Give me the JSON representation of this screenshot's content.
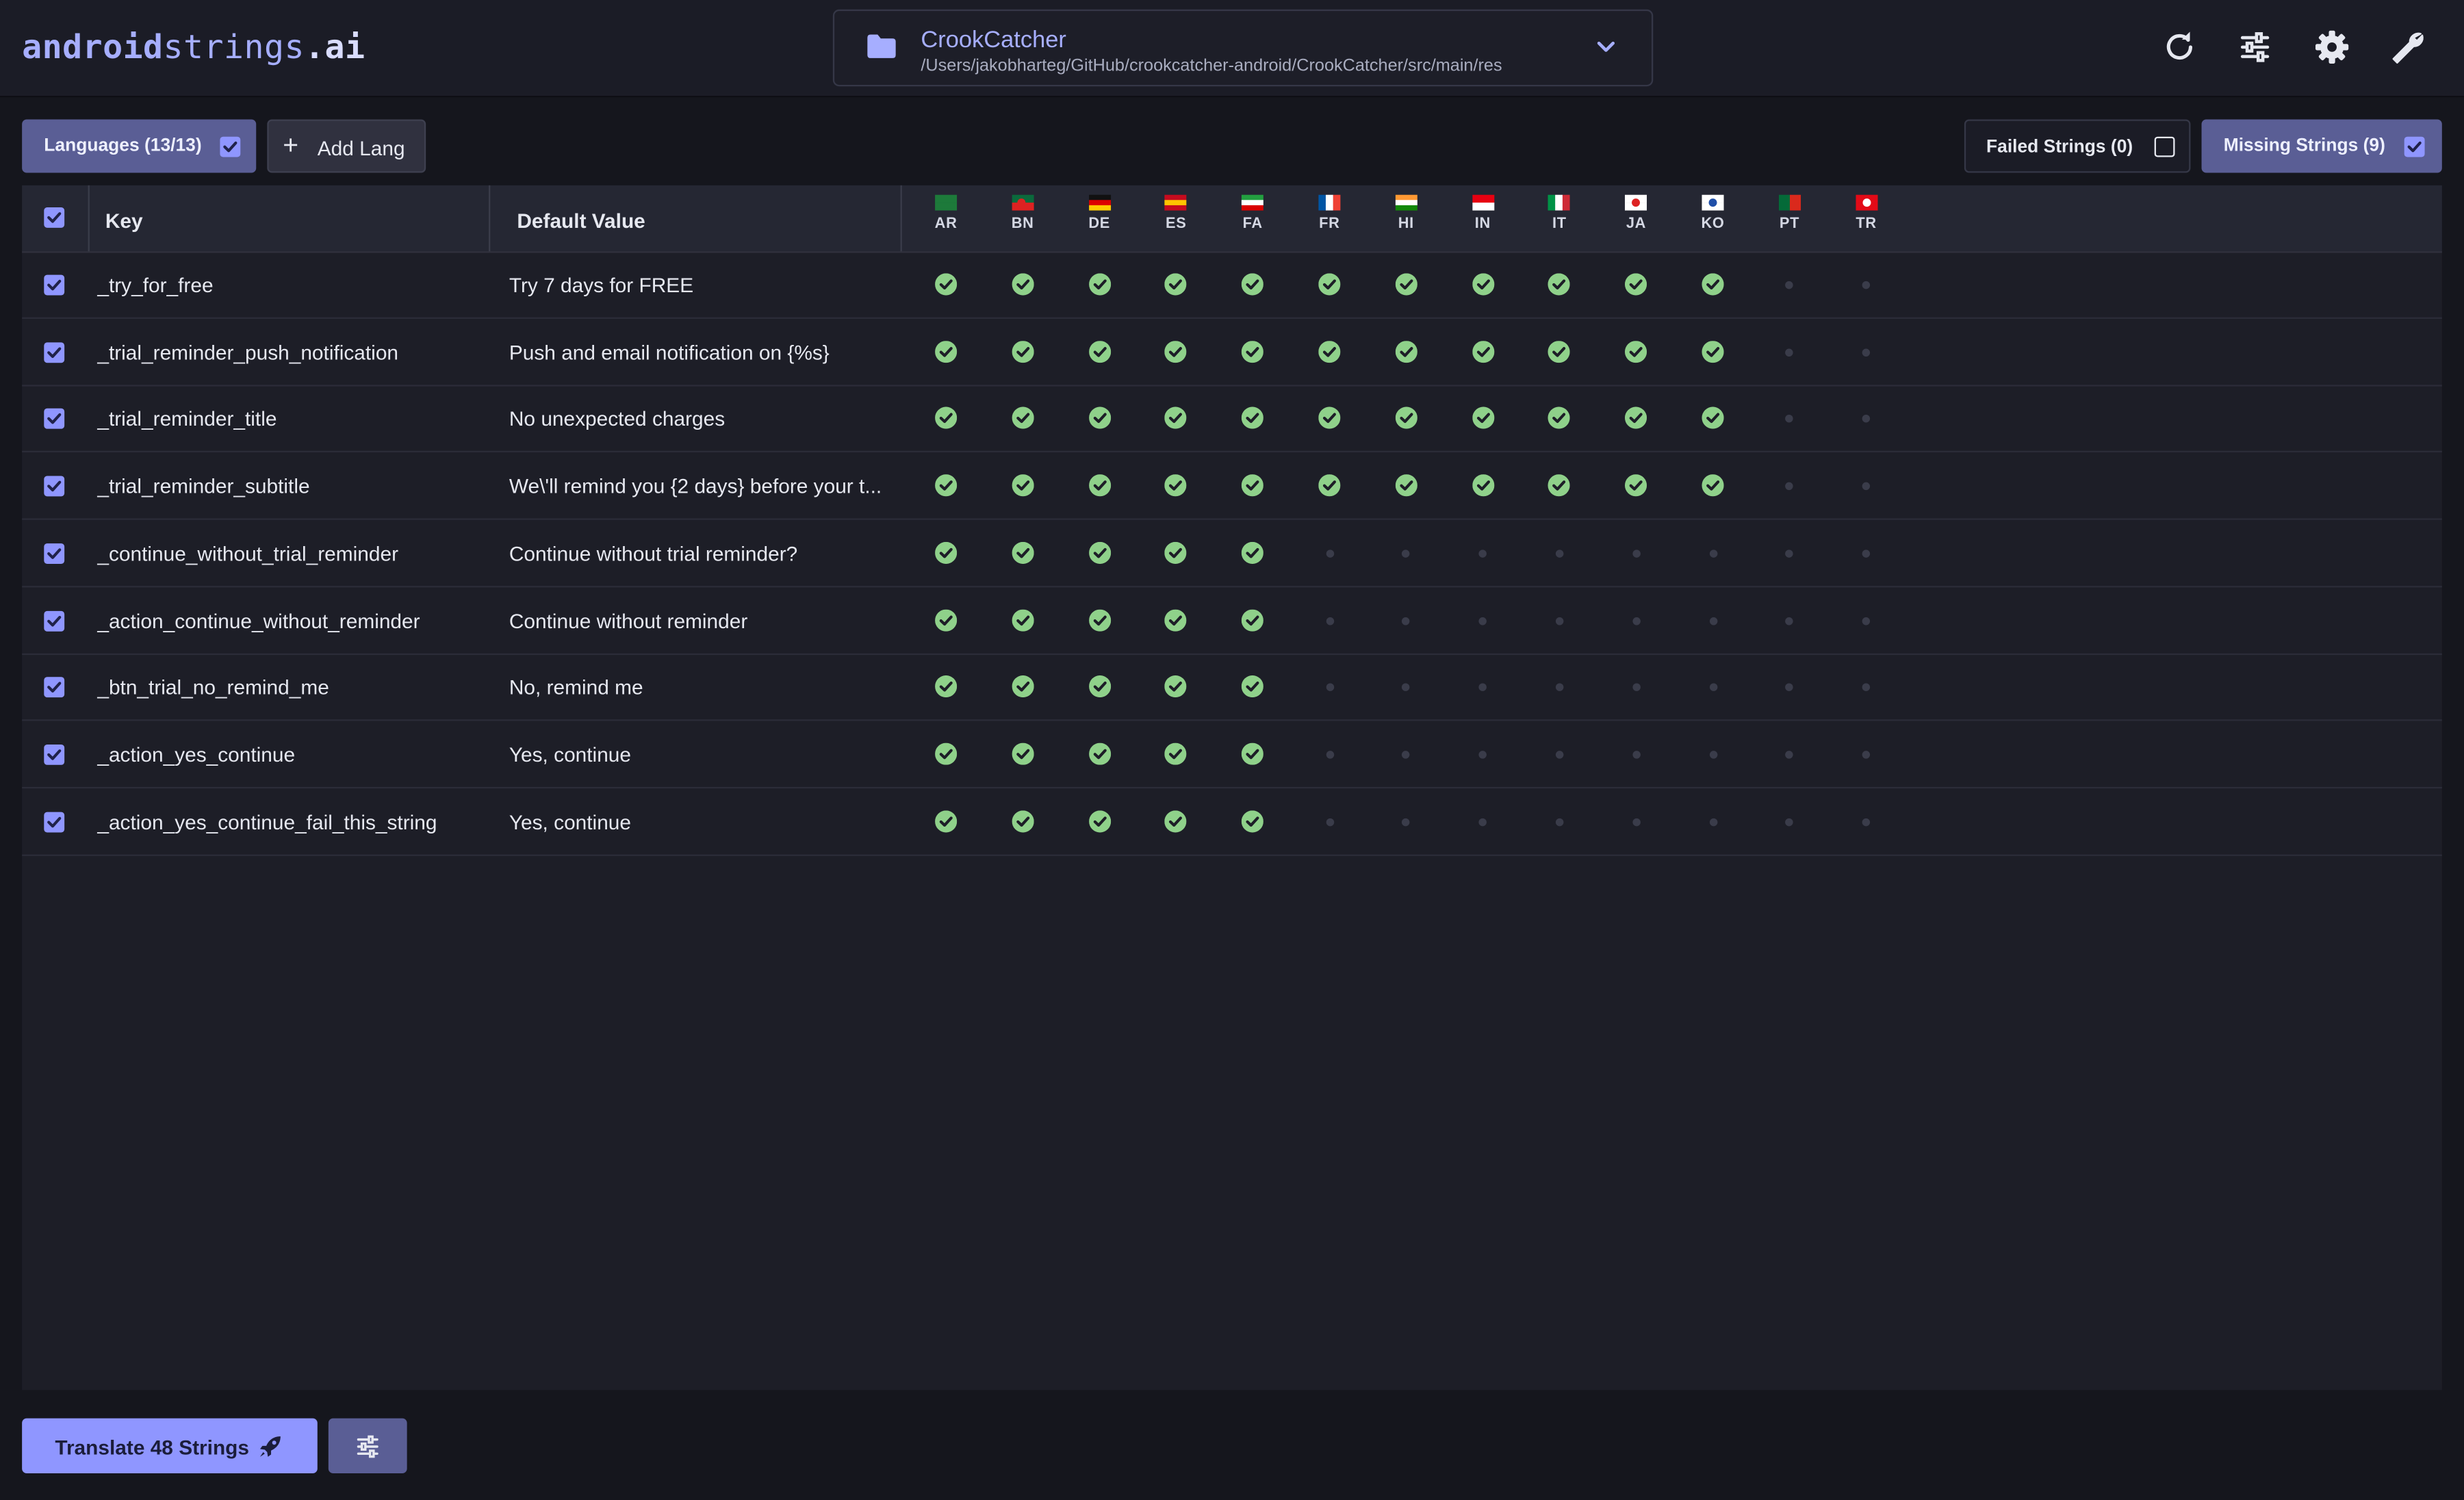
{
  "header": {
    "logo": {
      "part1": "android",
      "part2": "strings",
      "part3": ".ai"
    },
    "project": {
      "name": "CrookCatcher",
      "path": "/Users/jakobharteg/GitHub/crookcatcher-android/CrookCatcher/src/main/res"
    },
    "icons": [
      "refresh-icon",
      "sliders-icon",
      "gear-icon",
      "wrench-icon"
    ]
  },
  "toolbar": {
    "languages_label": "Languages (13/13)",
    "languages_checked": true,
    "add_lang_label": "Add Lang",
    "failed_label": "Failed Strings (0)",
    "failed_checked": false,
    "missing_label": "Missing Strings (9)",
    "missing_checked": true
  },
  "table": {
    "headers": {
      "key": "Key",
      "default": "Default Value"
    },
    "languages": [
      "AR",
      "BN",
      "DE",
      "ES",
      "FA",
      "FR",
      "HI",
      "IN",
      "IT",
      "JA",
      "KO",
      "PT",
      "TR"
    ],
    "rows": [
      {
        "key": "_try_for_free",
        "default": "Try 7 days for FREE",
        "done": 11
      },
      {
        "key": "_trial_reminder_push_notification",
        "default": "Push and email notification on {%s}",
        "done": 11
      },
      {
        "key": "_trial_reminder_title",
        "default": "No unexpected charges",
        "done": 11
      },
      {
        "key": "_trial_reminder_subtitle",
        "default": "We\\'ll remind you {2 days} before your t...",
        "done": 11
      },
      {
        "key": "_continue_without_trial_reminder",
        "default": "Continue without trial reminder?",
        "done": 5
      },
      {
        "key": "_action_continue_without_reminder",
        "default": "Continue without reminder",
        "done": 5
      },
      {
        "key": "_btn_trial_no_remind_me",
        "default": "No, remind me",
        "done": 5
      },
      {
        "key": "_action_yes_continue",
        "default": "Yes, continue",
        "done": 5
      },
      {
        "key": "_action_yes_continue_fail_this_string",
        "default": "Yes, continue",
        "done": 5
      }
    ]
  },
  "footer": {
    "translate_label": "Translate 48 Strings",
    "options_icon": "sliders-icon"
  },
  "colors": {
    "accent": "#8f96ff",
    "success": "#8fd18a",
    "bg": "#15161d"
  }
}
